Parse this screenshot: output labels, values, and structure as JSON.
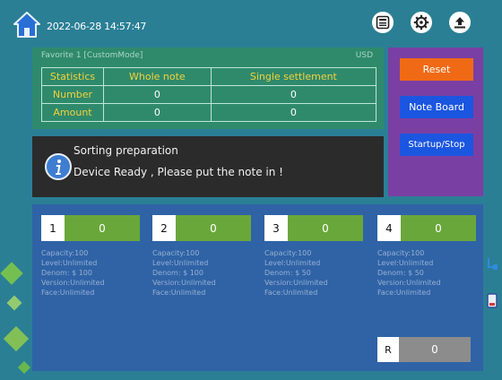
{
  "datetime": "2022-06-28 14:57:47",
  "icons": [
    "home-icon",
    "save-icon",
    "gear-icon",
    "upload-icon",
    "info-icon"
  ],
  "stats": {
    "mode_label": "Favorite 1 [CustomMode]",
    "currency": "USD",
    "headers": [
      "Statistics",
      "Whole note",
      "Single settlement"
    ],
    "rows": [
      {
        "label": "Number",
        "whole": "0",
        "single": "0"
      },
      {
        "label": "Amount",
        "whole": "0",
        "single": "0"
      }
    ]
  },
  "message": {
    "title": "Sorting preparation",
    "text": "Device Ready , Please put the note in !"
  },
  "buttons": {
    "reset": "Reset",
    "note_board": "Note Board",
    "startup_stop": "Startup/Stop"
  },
  "drawers": [
    {
      "num": "1",
      "count": "0",
      "info": [
        "Capacity:100",
        "Level:Unlimited",
        "Denom: $ 100",
        "Version:Unlimited",
        "Face:Unlimited"
      ]
    },
    {
      "num": "2",
      "count": "0",
      "info": [
        "Capacity:100",
        "Level:Unlimited",
        "Denom: $ 100",
        "Version:Unlimited",
        "Face:Unlimited"
      ]
    },
    {
      "num": "3",
      "count": "0",
      "info": [
        "Capacity:100",
        "Level:Unlimited",
        "Denom: $ 50",
        "Version:Unlimited",
        "Face:Unlimited"
      ]
    },
    {
      "num": "4",
      "count": "0",
      "info": [
        "Capacity:100",
        "Level:Unlimited",
        "Denom: $ 50",
        "Version:Unlimited",
        "Face:Unlimited"
      ]
    }
  ],
  "reject": {
    "label": "R",
    "count": "0"
  },
  "colors": {
    "background": "#2a7f95",
    "stats_panel": "#2f8a6c",
    "header_text": "#f3d23a",
    "reset_button": "#f06a16",
    "blue_button": "#1b56e0",
    "right_panel": "#7a3fa3",
    "drawers_panel": "#2f63a6",
    "count_green": "#6aa73a"
  }
}
